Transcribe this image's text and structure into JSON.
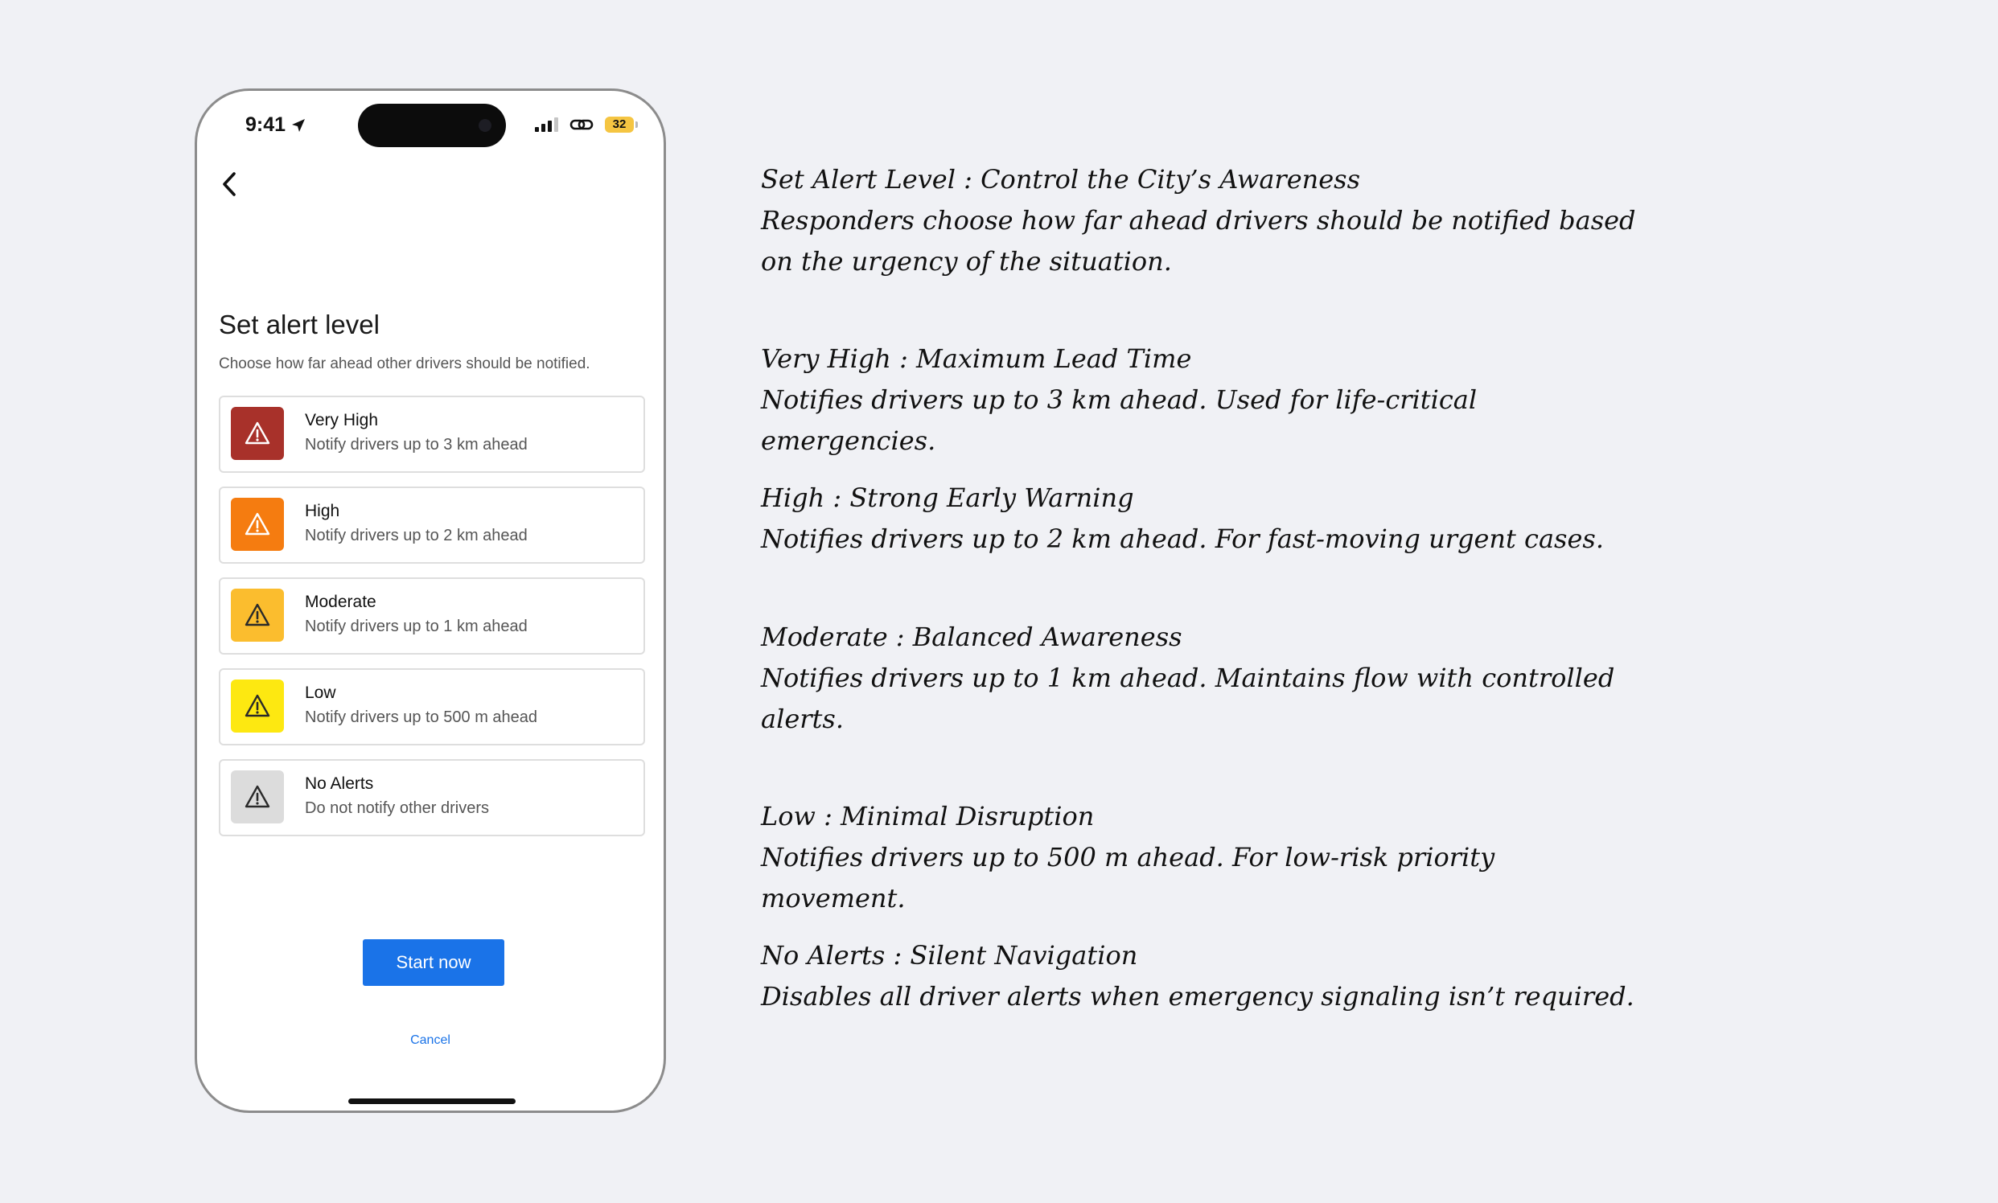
{
  "status_bar": {
    "time": "9:41",
    "battery": "32"
  },
  "screen": {
    "title": "Set alert level",
    "subtitle": "Choose how far ahead other drivers should be notified.",
    "options": [
      {
        "label": "Very High",
        "description": "Notify drivers up to 3 km ahead",
        "color": "#a8312a",
        "icon": "warning-icon"
      },
      {
        "label": "High",
        "description": "Notify drivers up to 2 km ahead",
        "color": "#f57c10",
        "icon": "warning-icon"
      },
      {
        "label": "Moderate",
        "description": "Notify drivers up to 1 km ahead",
        "color": "#fbbd2e",
        "icon": "warning-icon"
      },
      {
        "label": "Low",
        "description": "Notify drivers up to 500 m ahead",
        "color": "#fde811",
        "icon": "warning-icon"
      },
      {
        "label": "No Alerts",
        "description": "Do not notify other drivers",
        "color": "#dcdcdc",
        "icon": "warning-icon"
      }
    ],
    "start_label": "Start now",
    "cancel_label": "Cancel",
    "accent": "#1a73e8"
  },
  "annotations": [
    {
      "heading": "Set Alert Level : Control the City’s Awareness",
      "body": "Responders choose how far ahead drivers should be notified based on the urgency of the situation."
    },
    {
      "heading": "Very High : Maximum Lead Time",
      "body": "Notifies drivers up to 3 km ahead. Used for life-critical emergencies."
    },
    {
      "heading": "High : Strong Early Warning",
      "body": "Notifies drivers up to 2 km ahead. For fast-moving urgent cases."
    },
    {
      "heading": "Moderate : Balanced Awareness",
      "body": "Notifies drivers up to 1 km ahead. Maintains flow with controlled alerts."
    },
    {
      "heading": "Low : Minimal Disruption",
      "body": "Notifies drivers up to 500 m ahead. For low-risk priority movement."
    },
    {
      "heading": "No Alerts : Silent Navigation",
      "body": "Disables all driver alerts when emergency signaling isn’t required."
    }
  ]
}
